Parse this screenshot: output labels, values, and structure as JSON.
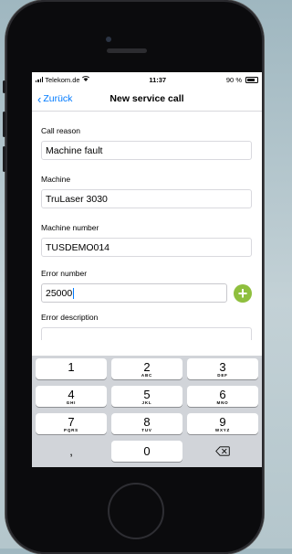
{
  "status": {
    "carrier": "Telekom.de",
    "time": "11:37",
    "battery": "90 %"
  },
  "nav": {
    "back_label": "Zurück",
    "title": "New service call"
  },
  "form": {
    "call_reason": {
      "label": "Call reason",
      "value": "Machine fault"
    },
    "machine": {
      "label": "Machine",
      "value": "TruLaser 3030"
    },
    "machine_number": {
      "label": "Machine number",
      "value": "TUSDEMO014"
    },
    "error_number": {
      "label": "Error number",
      "value": "25000"
    },
    "error_description": {
      "label": "Error description",
      "value": ""
    }
  },
  "keyboard": {
    "keys": [
      {
        "digit": "1",
        "letters": ""
      },
      {
        "digit": "2",
        "letters": "ABC"
      },
      {
        "digit": "3",
        "letters": "DEF"
      },
      {
        "digit": "4",
        "letters": "GHI"
      },
      {
        "digit": "5",
        "letters": "JKL"
      },
      {
        "digit": "6",
        "letters": "MNO"
      },
      {
        "digit": "7",
        "letters": "PQRS"
      },
      {
        "digit": "8",
        "letters": "TUV"
      },
      {
        "digit": "9",
        "letters": "WXYZ"
      },
      {
        "digit": ",",
        "letters": ""
      },
      {
        "digit": "0",
        "letters": ""
      }
    ],
    "delete_icon": "backspace-icon"
  },
  "icons": {
    "add": "plus-circle-icon",
    "back": "chevron-left-icon",
    "wifi": "wifi-icon",
    "signal": "signal-icon",
    "battery": "battery-icon"
  },
  "colors": {
    "accent": "#007aff",
    "add_button": "#8fbf3e"
  }
}
